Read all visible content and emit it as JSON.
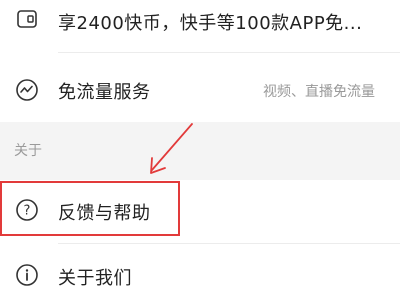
{
  "rows": [
    {
      "label": "享2400快币，快手等100款APP免...",
      "icon": "coin-card-icon"
    },
    {
      "label": "免流量服务",
      "sub": "视频、直播免流量",
      "icon": "traffic-wave-icon"
    }
  ],
  "section": {
    "title": "关于"
  },
  "about_items": [
    {
      "label": "反馈与帮助",
      "icon": "help-question-icon"
    },
    {
      "label": "关于我们",
      "icon": "info-icon"
    }
  ],
  "colors": {
    "annotation": "#e23a3a",
    "section_bg": "#f4f4f4",
    "text": "#222222",
    "subtext": "#999999"
  }
}
